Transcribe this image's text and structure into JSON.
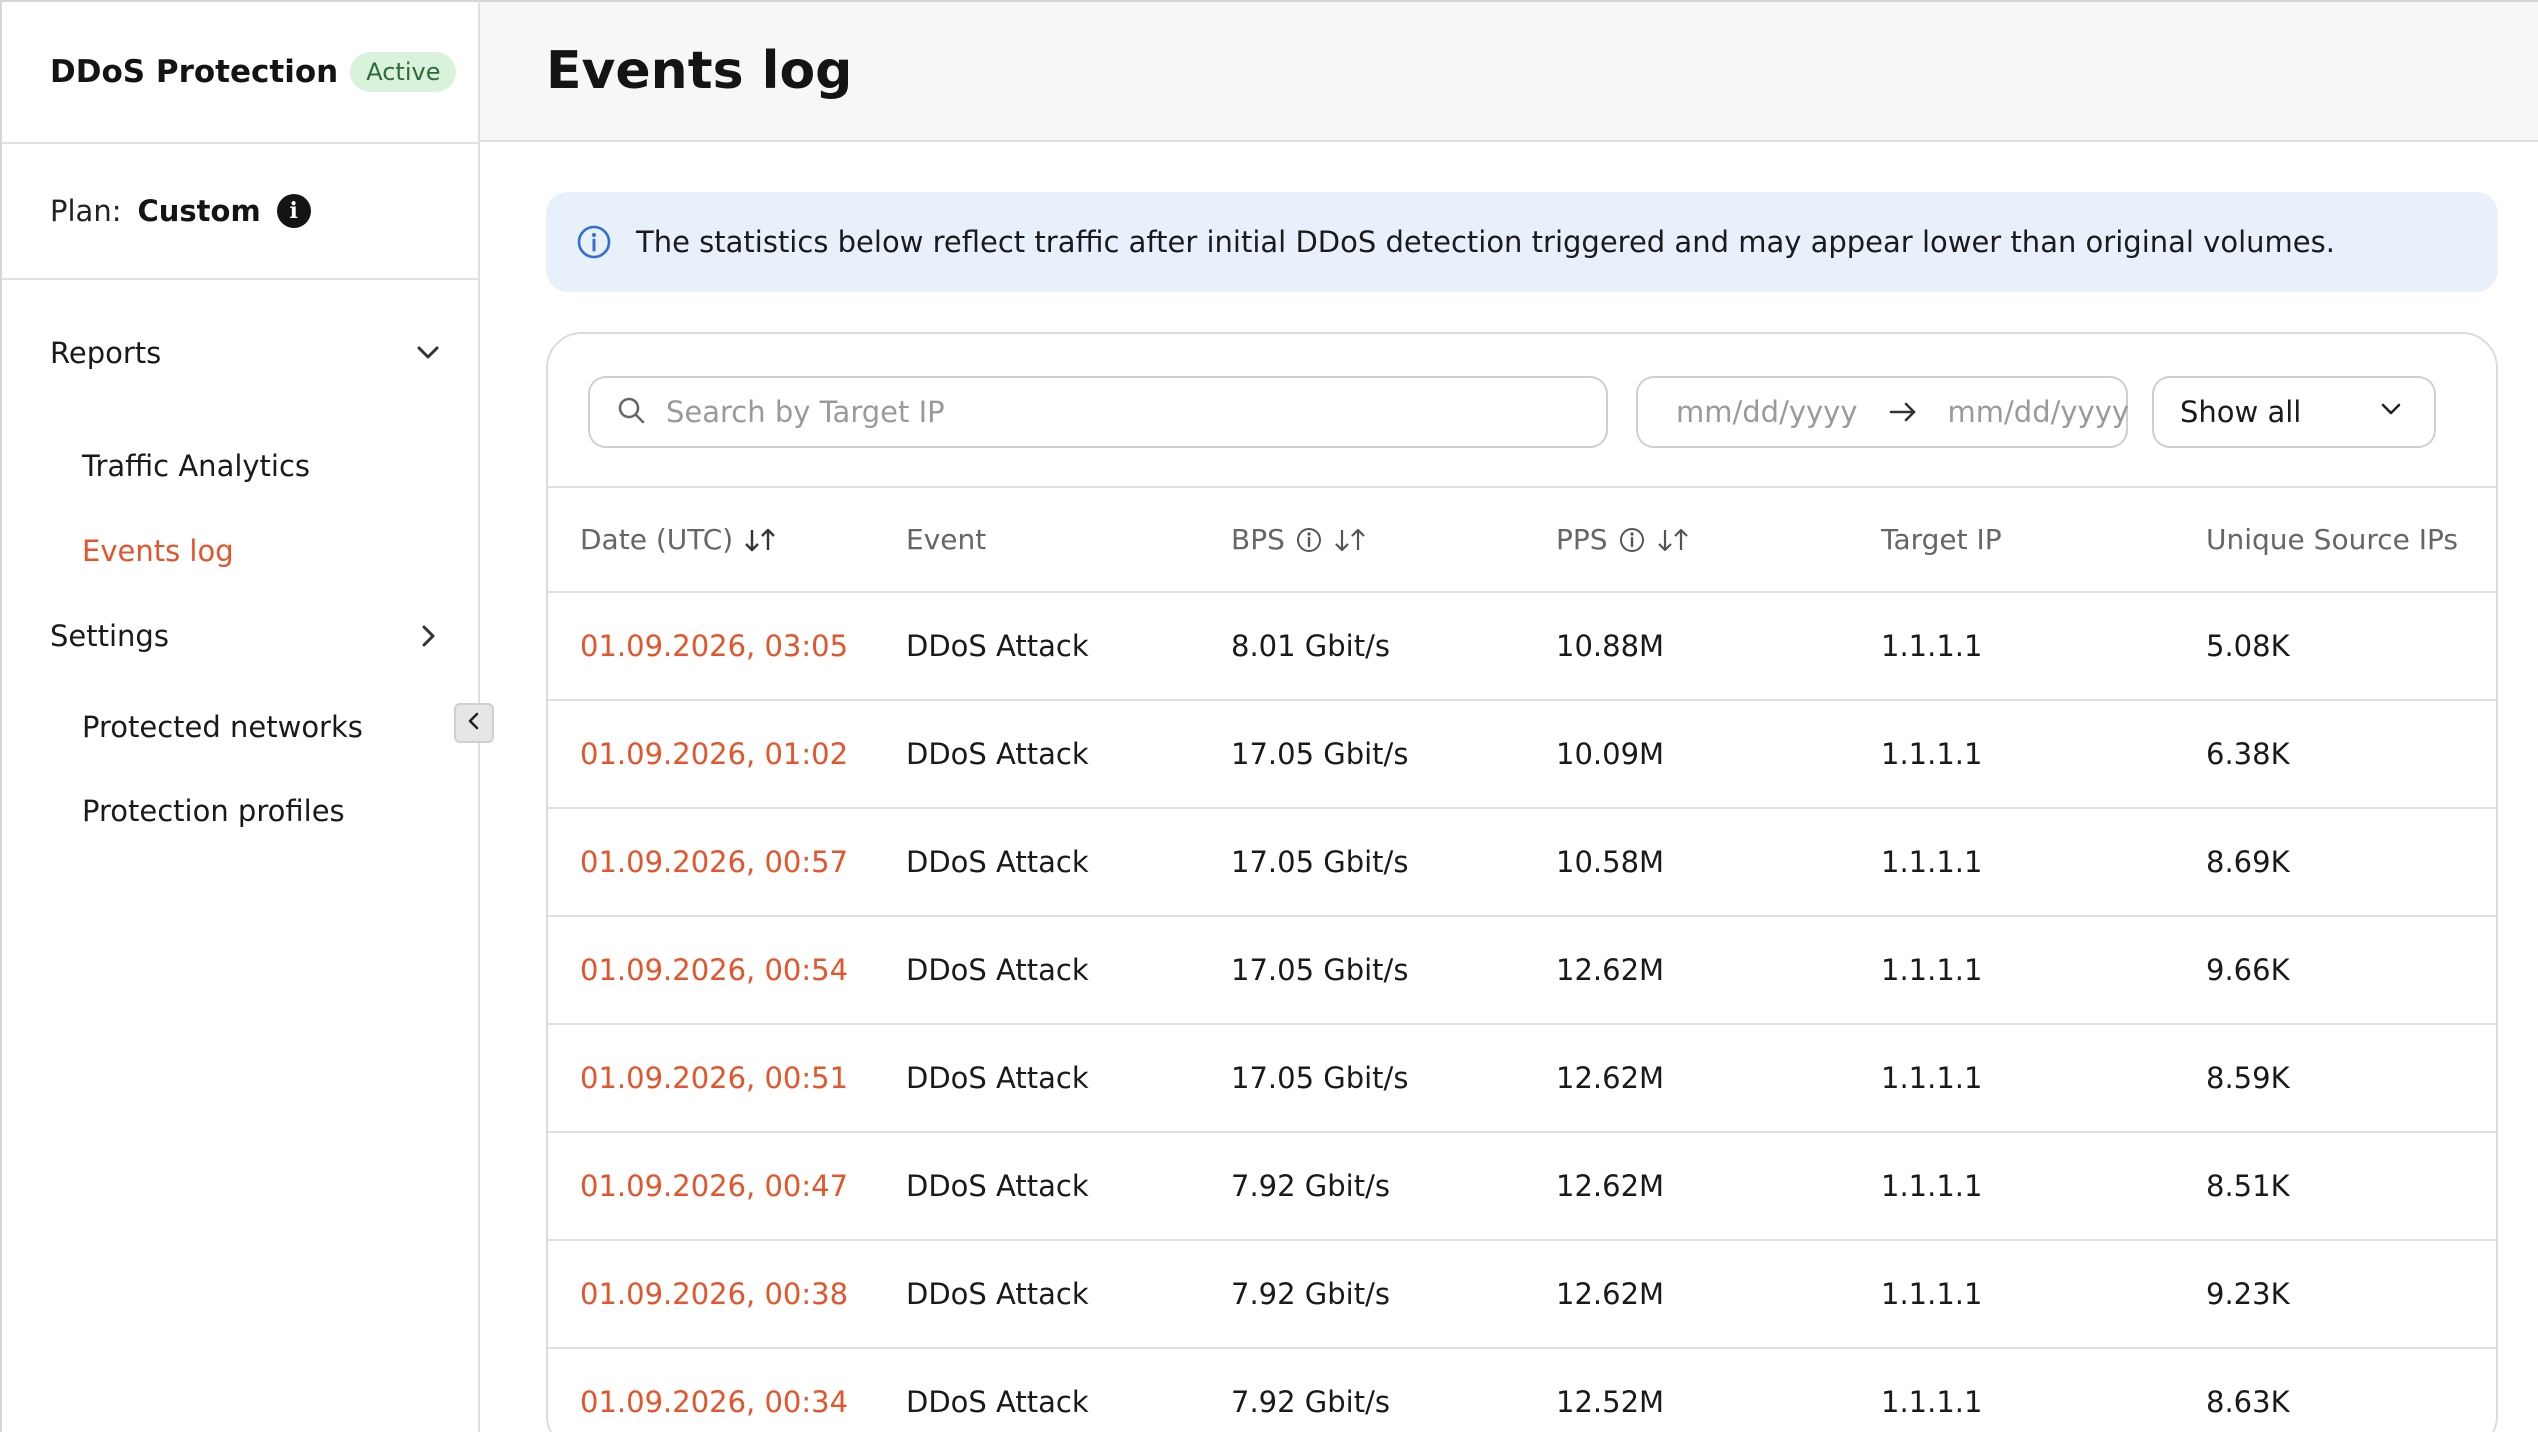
{
  "sidebar": {
    "title": "DDoS Protection",
    "status_badge": "Active",
    "plan_label": "Plan:",
    "plan_value": "Custom",
    "groups": [
      {
        "label": "Reports",
        "expanded": true,
        "items": [
          {
            "label": "Traffic Analytics",
            "active": false
          },
          {
            "label": "Events log",
            "active": true
          }
        ]
      },
      {
        "label": "Settings",
        "expanded": false,
        "items": [
          {
            "label": "Protected networks",
            "active": false
          },
          {
            "label": "Protection profiles",
            "active": false
          }
        ]
      }
    ]
  },
  "page": {
    "title": "Events log",
    "banner_text": "The statistics below reflect traffic after initial DDoS detection triggered and may appear lower than original volumes."
  },
  "filters": {
    "search_placeholder": "Search by Target IP",
    "date_from_placeholder": "mm/dd/yyyy",
    "date_to_placeholder": "mm/dd/yyyy",
    "show_select_value": "Show all"
  },
  "table": {
    "columns": [
      "Date (UTC)",
      "Event",
      "BPS",
      "PPS",
      "Target IP",
      "Unique Source IPs"
    ],
    "rows": [
      [
        "01.09.2026, 03:05",
        "DDoS Attack",
        "8.01 Gbit/s",
        "10.88M",
        "1.1.1.1",
        "5.08K"
      ],
      [
        "01.09.2026, 01:02",
        "DDoS Attack",
        "17.05 Gbit/s",
        "10.09M",
        "1.1.1.1",
        "6.38K"
      ],
      [
        "01.09.2026, 00:57",
        "DDoS Attack",
        "17.05 Gbit/s",
        "10.58M",
        "1.1.1.1",
        "8.69K"
      ],
      [
        "01.09.2026, 00:54",
        "DDoS Attack",
        "17.05 Gbit/s",
        "12.62M",
        "1.1.1.1",
        "9.66K"
      ],
      [
        "01.09.2026, 00:51",
        "DDoS Attack",
        "17.05 Gbit/s",
        "12.62M",
        "1.1.1.1",
        "8.59K"
      ],
      [
        "01.09.2026, 00:47",
        "DDoS Attack",
        "7.92 Gbit/s",
        "12.62M",
        "1.1.1.1",
        "8.51K"
      ],
      [
        "01.09.2026, 00:38",
        "DDoS Attack",
        "7.92 Gbit/s",
        "12.62M",
        "1.1.1.1",
        "9.23K"
      ],
      [
        "01.09.2026, 00:34",
        "DDoS Attack",
        "7.92 Gbit/s",
        "12.52M",
        "1.1.1.1",
        "8.63K"
      ]
    ]
  },
  "icons": {
    "banner": "info-outline-icon",
    "plan_info": "info-filled-icon",
    "search": "search-icon",
    "date_arrow": "arrow-right-icon",
    "select": "chevron-down-icon",
    "sort": "sort-arrows-icon",
    "collapse": "chevron-left-icon"
  },
  "colors": {
    "accent": "#e4552b",
    "badge_bg": "#d9f2dc",
    "badge_text": "#2f6b3a",
    "banner_bg": "#e8f0fb",
    "info_blue": "#2f6fd6"
  }
}
